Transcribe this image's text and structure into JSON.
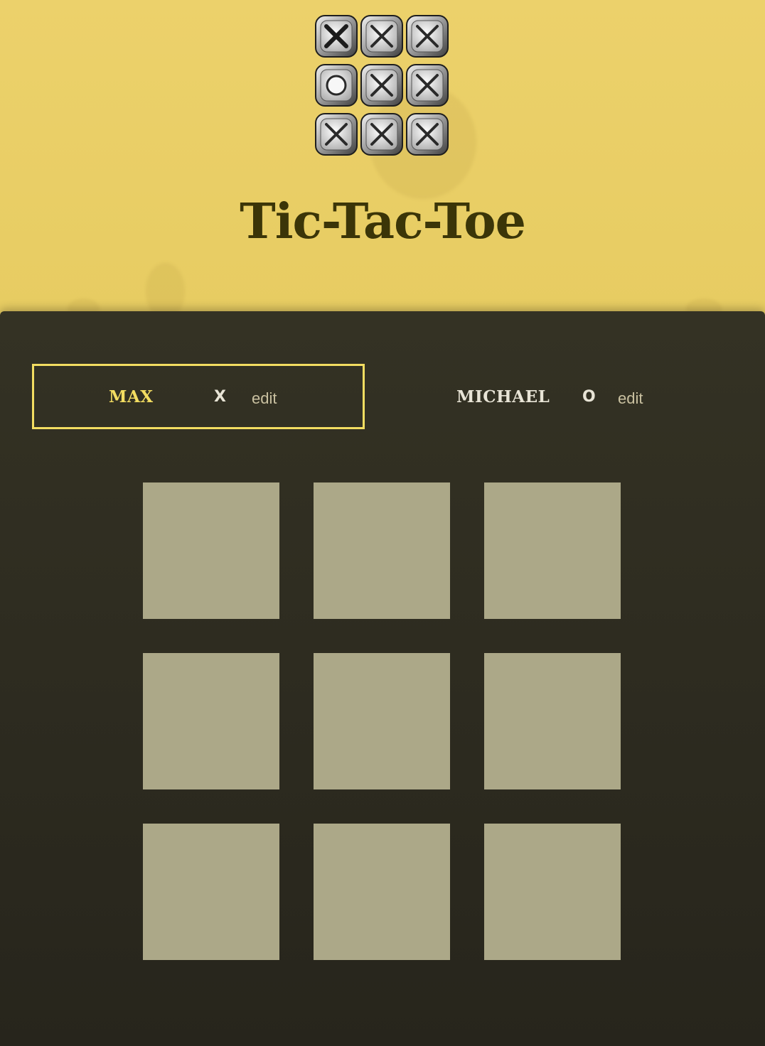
{
  "header": {
    "title": "Tic-Tac-Toe",
    "logo_icon": "tic-tac-toe-logo-icon"
  },
  "players": [
    {
      "name": "MAX",
      "symbol": "X",
      "edit_label": "edit",
      "active": true
    },
    {
      "name": "MICHAEL",
      "symbol": "O",
      "edit_label": "edit",
      "active": false
    }
  ],
  "board": {
    "cells": [
      "",
      "",
      "",
      "",
      "",
      "",
      "",
      "",
      ""
    ]
  },
  "colors": {
    "header_bg": "#e9cf67",
    "title": "#3b3508",
    "main_bg": "#302e22",
    "active_highlight": "#f3dd61",
    "cell": "#aca888"
  }
}
